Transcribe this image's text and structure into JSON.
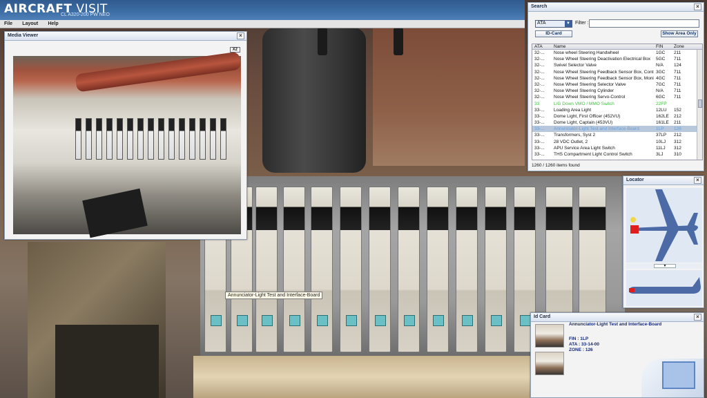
{
  "app": {
    "logo_main": "AIRCRAFT",
    "logo_thin": " VISIT",
    "subtitle": "CL A320-200 PW NEO"
  },
  "menu": [
    "File",
    "Layout",
    "Help"
  ],
  "media_viewer": {
    "title": "Media Viewer",
    "zoom_button": "X2",
    "close": "×"
  },
  "search": {
    "title": "Search",
    "close": "×",
    "category_value": "ATA",
    "filter_label": "Filter :",
    "filter_value": "",
    "idcard_button": "ID-Card",
    "show_area_button": "Show Area Only",
    "columns": [
      "ATA",
      "Name",
      "FIN",
      "Zone"
    ],
    "rows": [
      {
        "ata": "32-...",
        "name": "Nose wheel Steering Handwheel",
        "fin": "1GC",
        "zone": "211"
      },
      {
        "ata": "32-...",
        "name": "Nose Wheel Steering Deactivation Electrical Box",
        "fin": "5GC",
        "zone": "711"
      },
      {
        "ata": "32-...",
        "name": "Swivel Selector Valve",
        "fin": "N/A",
        "zone": "124"
      },
      {
        "ata": "32-...",
        "name": "Nose Wheel Steering Feedback Sensor Box, Contr...",
        "fin": "3GC",
        "zone": "711"
      },
      {
        "ata": "32-...",
        "name": "Nose Wheel Steering Feedback Sensor Box, Moni...",
        "fin": "4GC",
        "zone": "711"
      },
      {
        "ata": "32-...",
        "name": "Nose Wheel Steering Selector Valve",
        "fin": "7GC",
        "zone": "711"
      },
      {
        "ata": "32-...",
        "name": "Nose Wheel Steering Cylinder",
        "fin": "N/A",
        "zone": "711"
      },
      {
        "ata": "32-...",
        "name": "Nose Wheel Steering Servo-Control",
        "fin": "6GC",
        "zone": "711"
      },
      {
        "ata": "33",
        "name": "L/G Down VMO / MMO Switch",
        "fin": "22FP",
        "zone": ""
      },
      {
        "ata": "33-...",
        "name": "Loading Area Light",
        "fin": "12LU",
        "zone": "152"
      },
      {
        "ata": "33-...",
        "name": "Dome Light, First Officer (452VU)",
        "fin": "162LE",
        "zone": "212"
      },
      {
        "ata": "33-...",
        "name": "Dome Light, Captain (453VU)",
        "fin": "161LE",
        "zone": "211"
      },
      {
        "ata": "33-...",
        "name": "Annunciator-Light Test and Interface-Board",
        "fin": "1LP",
        "zone": "126"
      },
      {
        "ata": "33-...",
        "name": "Transformers, Syst 2",
        "fin": "37LP",
        "zone": "212"
      },
      {
        "ata": "33-...",
        "name": "28 VDC Outlet, 2",
        "fin": "10LJ",
        "zone": "312"
      },
      {
        "ata": "33-...",
        "name": "APU Service Area Light Switch",
        "fin": "11LJ",
        "zone": "312"
      },
      {
        "ata": "33-...",
        "name": "THS Compartment Light Control Switch",
        "fin": "3LJ",
        "zone": "310"
      }
    ],
    "items_found": "1260 / 1260 items found"
  },
  "locator": {
    "title": "Locator",
    "close": "×"
  },
  "idcard": {
    "title": "Id Card",
    "close": "×",
    "name": "Annunciator-Light Test and Interface-Board",
    "fin": "FIN : 1LP",
    "ata": "ATA : 33-14-00",
    "zone": "ZONE : 126"
  },
  "tooltip": "Annunciator-Light Test and Interface-Board",
  "colors": {
    "title_blue": "#3e6ea6",
    "plane_blue": "#4b6aa6",
    "highlight_red": "#e01e1e",
    "list_green": "#3fbf3f"
  }
}
